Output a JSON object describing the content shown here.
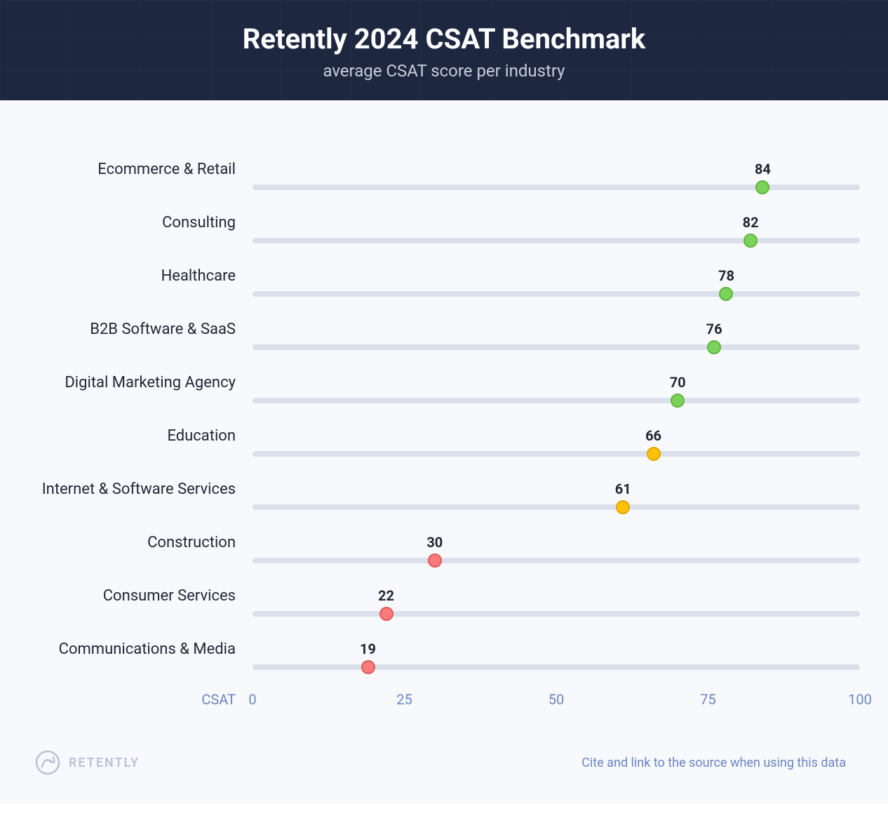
{
  "header": {
    "title": "Retently 2024 CSAT Benchmark",
    "subtitle": "average CSAT score per industry"
  },
  "axis": {
    "label": "CSAT",
    "ticks": [
      "0",
      "25",
      "50",
      "75",
      "100"
    ]
  },
  "footer": {
    "brand": "RETENTLY",
    "cite": "Cite and link to the source when using this data"
  },
  "colors": {
    "green": "#7cd35b",
    "yellow": "#ffc107",
    "red": "#ff7b7b"
  },
  "chart_data": {
    "type": "bar",
    "title": "Retently 2024 CSAT Benchmark",
    "subtitle": "average CSAT score per industry",
    "xlabel": "CSAT",
    "ylabel": "",
    "xlim": [
      0,
      100
    ],
    "categories": [
      "Ecommerce & Retail",
      "Consulting",
      "Healthcare",
      "B2B Software & SaaS",
      "Digital Marketing Agency",
      "Education",
      "Internet & Software Services",
      "Construction",
      "Consumer Services",
      "Communications & Media"
    ],
    "values": [
      84,
      82,
      78,
      76,
      70,
      66,
      61,
      30,
      22,
      19
    ],
    "colors_by_category": [
      "green",
      "green",
      "green",
      "green",
      "green",
      "yellow",
      "yellow",
      "red",
      "red",
      "red"
    ],
    "ticks": [
      0,
      25,
      50,
      75,
      100
    ]
  }
}
